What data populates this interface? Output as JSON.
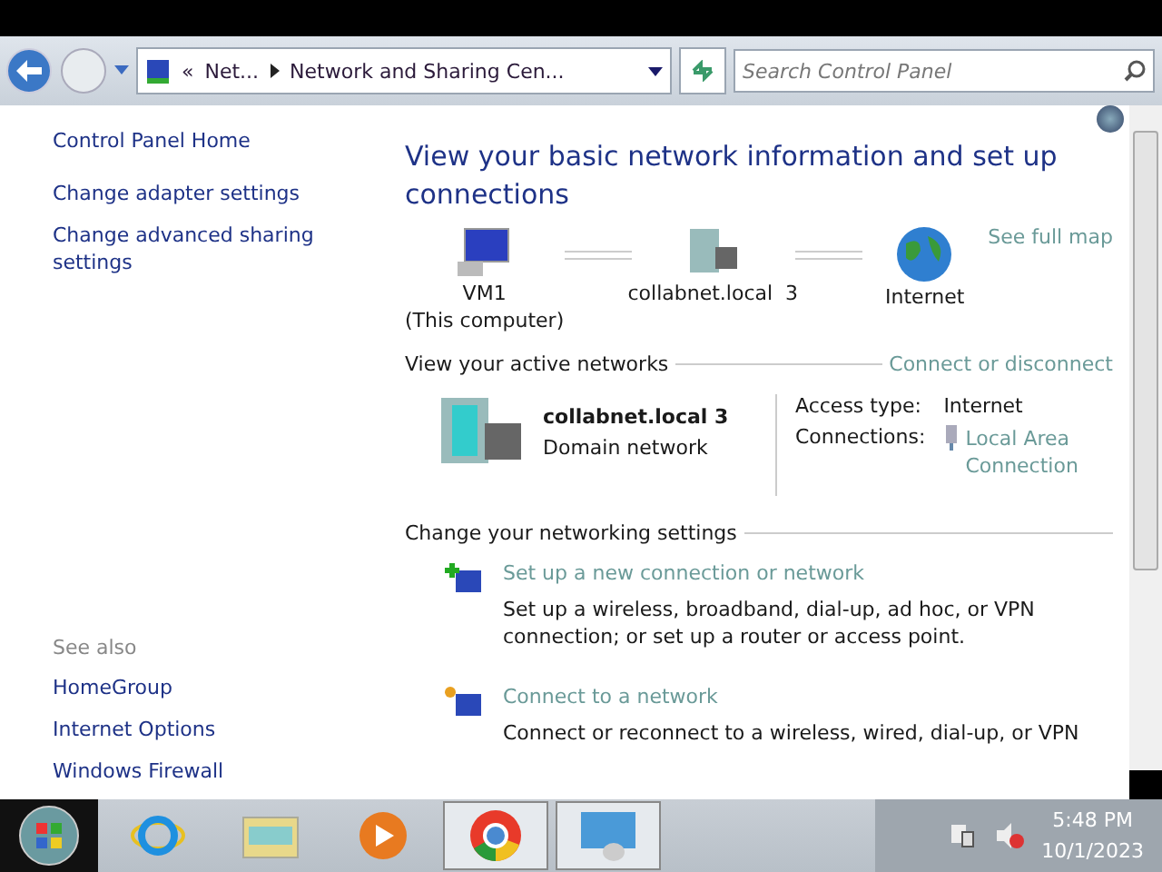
{
  "address_bar": {
    "crumbs": [
      "Net...",
      "Network and Sharing Cen..."
    ],
    "overflow": "«"
  },
  "search": {
    "placeholder": "Search Control Panel"
  },
  "sidebar": {
    "links": [
      "Control Panel Home",
      "Change adapter settings",
      "Change advanced sharing settings"
    ],
    "see_also_heading": "See also",
    "see_also": [
      "HomeGroup",
      "Internet Options",
      "Windows Firewall"
    ]
  },
  "main": {
    "title": "View your basic network information and set up connections",
    "see_full_map": "See full map",
    "map_nodes": [
      {
        "kind": "computer",
        "label": "VM1\n(This computer)"
      },
      {
        "kind": "network",
        "label": "collabnet.local  3"
      },
      {
        "kind": "internet",
        "label": "Internet"
      }
    ],
    "active_heading": "View your active networks",
    "connect_link": "Connect or disconnect",
    "network": {
      "name": "collabnet.local  3",
      "type": "Domain network",
      "access_label": "Access type:",
      "access_value": "Internet",
      "connections_label": "Connections:",
      "connection_link": "Local Area\nConnection"
    },
    "settings_heading": "Change your networking settings",
    "tasks": [
      {
        "kind": "new",
        "title": "Set up a new connection or network",
        "description": "Set up a wireless, broadband, dial-up, ad hoc, or VPN connection; or set up a router or access point."
      },
      {
        "kind": "connect",
        "title": "Connect to a network",
        "description": "Connect or reconnect to a wireless, wired, dial-up, or VPN"
      }
    ]
  },
  "taskbar": {
    "items": [
      {
        "kind": "ie",
        "active": false
      },
      {
        "kind": "explorer",
        "active": false
      },
      {
        "kind": "media",
        "active": false
      },
      {
        "kind": "chrome",
        "active": true
      },
      {
        "kind": "control",
        "active": true
      }
    ],
    "time": "5:48 PM",
    "date": "10/1/2023"
  }
}
